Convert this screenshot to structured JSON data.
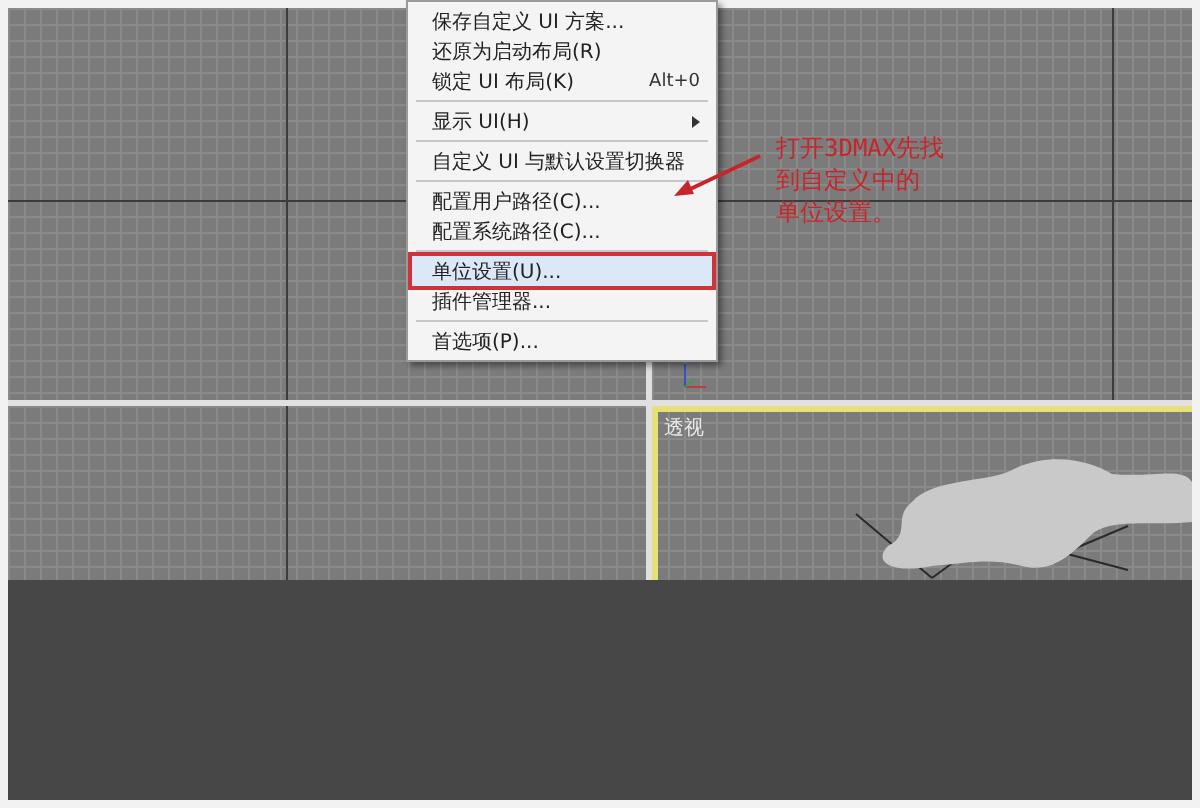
{
  "menu": {
    "items": [
      {
        "kind": "item",
        "label": "保存自定义 UI 方案...",
        "selected": false
      },
      {
        "kind": "item",
        "label": "还原为启动布局(R)",
        "selected": false
      },
      {
        "kind": "item",
        "label": "锁定 UI 布局(K)",
        "shortcut": "Alt+0",
        "selected": false
      },
      {
        "kind": "separator"
      },
      {
        "kind": "item",
        "label": "显示 UI(H)",
        "submenu": true,
        "selected": false
      },
      {
        "kind": "separator"
      },
      {
        "kind": "item",
        "label": "自定义 UI 与默认设置切换器",
        "selected": false
      },
      {
        "kind": "separator"
      },
      {
        "kind": "item",
        "label": "配置用户路径(C)...",
        "selected": false
      },
      {
        "kind": "item",
        "label": "配置系统路径(C)...",
        "selected": false
      },
      {
        "kind": "separator"
      },
      {
        "kind": "item",
        "label": "单位设置(U)...",
        "selected": true
      },
      {
        "kind": "item",
        "label": "插件管理器...",
        "selected": false
      },
      {
        "kind": "separator"
      },
      {
        "kind": "item",
        "label": "首选项(P)...",
        "selected": false
      }
    ]
  },
  "viewports": [
    {
      "active": false
    },
    {
      "active": false
    },
    {
      "active": false
    },
    {
      "label": "透视",
      "active": true
    }
  ],
  "annotation": {
    "lines": [
      "打开3DMAX先找",
      "到自定义中的",
      "单位设置。"
    ]
  }
}
